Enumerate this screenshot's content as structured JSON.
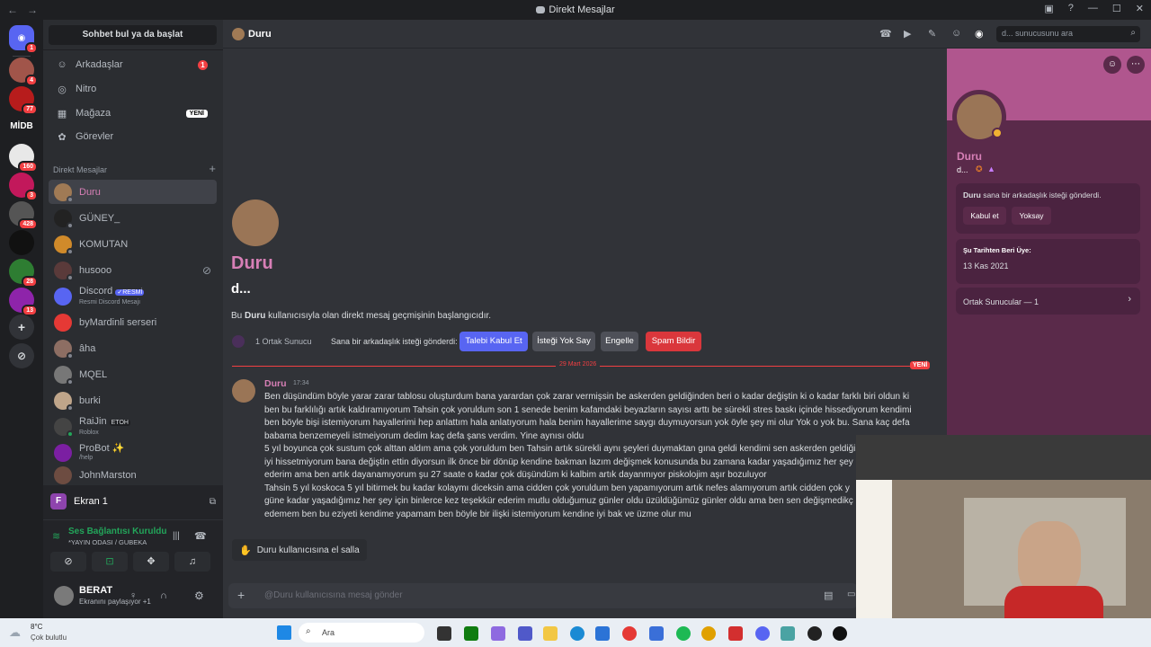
{
  "window": {
    "title": "Direkt Mesajlar"
  },
  "sidebar": {
    "search_label": "Sohbet bul ya da başlat",
    "nav": [
      {
        "label": "Arkadaşlar",
        "badge": "1",
        "icon": "friends-icon"
      },
      {
        "label": "Nitro",
        "icon": "nitro-icon"
      },
      {
        "label": "Mağaza",
        "badge": "YENİ",
        "icon": "shop-icon"
      },
      {
        "label": "Görevler",
        "icon": "quests-icon"
      }
    ],
    "dm_header": "Direkt Mesajlar",
    "dms": [
      {
        "name": "Duru",
        "sub": ""
      },
      {
        "name": "GÜNEY_",
        "sub": ""
      },
      {
        "name": "KOMUTAN",
        "sub": ""
      },
      {
        "name": "husooo",
        "sub": ""
      },
      {
        "name": "Discord",
        "sub": "Resmi Discord Mesajı",
        "tag": "✓RESMİ"
      },
      {
        "name": "byMardinli serseri",
        "sub": ""
      },
      {
        "name": "âha",
        "sub": ""
      },
      {
        "name": "MQEL",
        "sub": ""
      },
      {
        "name": "burki",
        "sub": ""
      },
      {
        "name": "RaiJin",
        "sub": "Roblox",
        "tag": "ETOH"
      },
      {
        "name": "ProBot ✨",
        "sub": "/help"
      },
      {
        "name": "JohnMarston",
        "sub": ""
      }
    ]
  },
  "guild_badges": [
    "1",
    "4",
    "77",
    "160",
    "3",
    "428",
    "28",
    "13"
  ],
  "guild_label_midb": "MİDB",
  "screen_share": {
    "label": "Ekran 1",
    "initial": "F"
  },
  "voice": {
    "status": "Ses Bağlantısı Kuruldu",
    "channel": "*YAYIN ODASI / GUBEKA"
  },
  "user": {
    "name": "BERAT",
    "status": "Ekranını paylaşıyor +1"
  },
  "chat": {
    "header_name": "Duru",
    "search_placeholder": "d... sunucusunu ara",
    "intro_name": "Duru",
    "intro_sub": "d...",
    "intro_text_pre": "Bu ",
    "intro_text_name": "Duru",
    "intro_text_post": " kullanıcısıyla olan direkt mesaj geçmişinin başlangıcıdır.",
    "mutual": "1 Ortak Sunucu",
    "friend_req": "Sana bir arkadaşlık isteği gönderdi:",
    "accept": "Talebi Kabul Et",
    "ignore": "İsteği Yok Say",
    "block": "Engelle",
    "report": "Spam Bildir",
    "divider_date": "29 Mart 2026",
    "new_badge": "YENİ",
    "message": {
      "author": "Duru",
      "time": "17:34",
      "lines": [
        "Ben düşündüm böyle yarar zarar tablosu oluşturdum bana yarardan çok zarar vermişsin be askerden geldiğinden beri o kadar değiştin ki o kadar farklı biri oldun ki",
        "ben bu farklılığı artık kaldıramıyorum Tahsin çok yoruldum son 1 senede benim kafamdaki beyazların sayısı arttı be sürekli stres baskı içinde hissediyorum kendimi",
        "ben böyle bişi istemiyorum hayallerimi hep anlattım hala anlatıyorum hala benim hayallerime saygı duymuyorsun yok öyle şey mi olur Yok o yok bu. Sana kaç defa",
        "babama benzemeyeli istmeiyorum dedim kaç defa şans verdim. Yine aynısı oldu",
        "5 yıl boyunca çok sustum çok alttan aldım ama çok yoruldum ben Tahsin artık sürekli aynı şeyleri duymaktan gına geldi kendimi sen askerden geldiğinden beri hiç",
        "iyi hissetmiyorum bana değiştin ettin diyorsun ilk önce bir dönüp kendine bakman lazım değişmek konusunda bu zamana kadar yaşadığımız her şey için teşekkür",
        "ederim ama ben artık dayanamıyorum şu 27 saate o kadar çok düşündüm ki kalbim artık dayanmıyor piskolojim aşır bozuluyor",
        "Tahsin 5 yıl koskoca 5 yıl bitirmek bu kadar kolaymı diceksin ama cidden çok yoruldum ben yapamıyorum artık nefes alamıyorum artık cidden çok y",
        "güne kadar yaşadığımız her şey için binlerce kez teşekkür ederim mutlu olduğumuz günler oldu üzüldüğümüz günler oldu ama ben sen değişmedikç",
        "edemem ben bu eziyeti kendime yapamam ben böyle bir ilişki istemiyorum kendine iyi bak ve üzme olur mu"
      ]
    },
    "wave": "Duru kullanıcısına el salla",
    "composer_placeholder": "@Duru kullanıcısına mesaj gönder"
  },
  "profile": {
    "name": "Duru",
    "sub": "d...",
    "req_text_name": "Duru",
    "req_text_rest": " sana bir arkadaşlık isteği gönderdi.",
    "accept": "Kabul et",
    "ignore": "Yoksay",
    "member_since_label": "Şu Tarihten Beri Üye:",
    "member_since": "13 Kas 2021",
    "mutual_servers": "Ortak Sunucular — 1"
  },
  "taskbar": {
    "temp": "8°C",
    "weather": "Çok bulutlu",
    "search": "Ara"
  },
  "colors": {
    "accent": "#5865f2",
    "danger": "#da373c",
    "name_pink": "#d77fb6"
  }
}
